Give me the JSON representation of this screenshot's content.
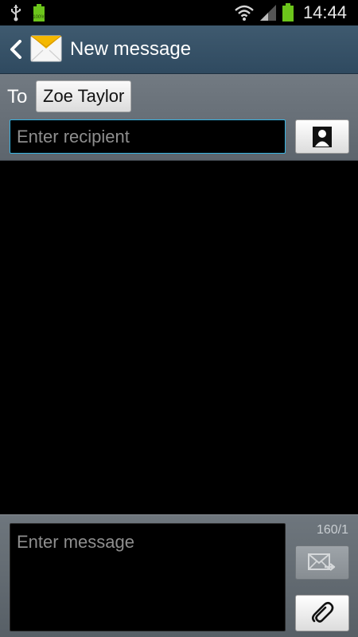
{
  "status_bar": {
    "time": "14:44",
    "battery_label": "100%",
    "icons": [
      "usb-icon",
      "battery-small-icon",
      "wifi-icon",
      "signal-icon",
      "battery-icon"
    ],
    "battery_color": "#6cc51b"
  },
  "header": {
    "title": "New message",
    "back_icon": "chevron-left-icon",
    "app_icon": "envelope-icon",
    "background_color": "#3a5469"
  },
  "recipients": {
    "to_label": "To",
    "chips": [
      {
        "label": "Zoe Taylor"
      }
    ],
    "input_placeholder": "Enter recipient",
    "input_value": "",
    "contact_button_icon": "contact-icon",
    "focus_color": "#39b5e3"
  },
  "compose": {
    "placeholder": "Enter message",
    "value": "",
    "char_counter": "160/1",
    "send_icon": "send-envelope-icon",
    "attach_icon": "paperclip-icon"
  }
}
